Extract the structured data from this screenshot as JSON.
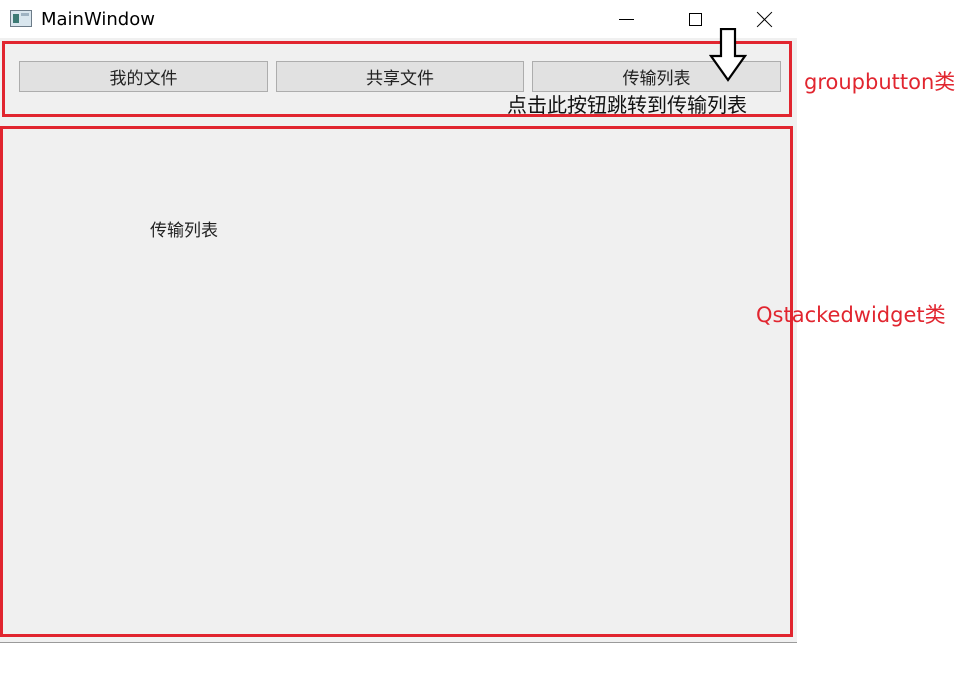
{
  "window": {
    "title": "MainWindow"
  },
  "group_buttons": {
    "buttons": [
      {
        "label": "我的文件"
      },
      {
        "label": "共享文件"
      },
      {
        "label": "传输列表"
      }
    ]
  },
  "hint": {
    "text": "点击此按钮跳转到传输列表"
  },
  "stacked_widget": {
    "current_page_label": "传输列表"
  },
  "annotations": {
    "group_label": "groupbutton类",
    "stack_label": "Qstackedwidget类",
    "highlight_color": "#e1252f"
  }
}
